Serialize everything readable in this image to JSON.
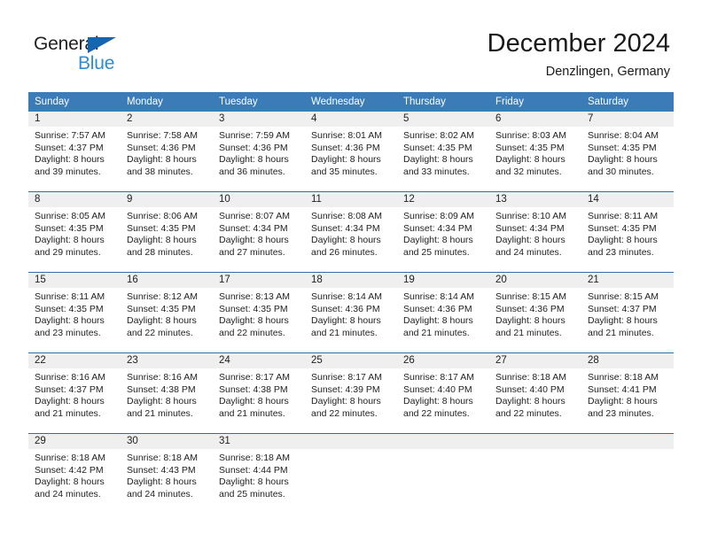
{
  "brand": {
    "name_part1": "General",
    "name_part2": "Blue",
    "triangle_color": "#1565b0",
    "blue_text_color": "#2b8cd9"
  },
  "header": {
    "title": "December 2024",
    "subtitle": "Denzlingen, Germany"
  },
  "theme": {
    "header_bg": "#3b7cb8",
    "header_text": "#ffffff",
    "daynum_bg": "#efefef",
    "row_divider": "#2f6ea8"
  },
  "columns": [
    "Sunday",
    "Monday",
    "Tuesday",
    "Wednesday",
    "Thursday",
    "Friday",
    "Saturday"
  ],
  "weeks": [
    [
      {
        "day": "1",
        "sunrise": "Sunrise: 7:57 AM",
        "sunset": "Sunset: 4:37 PM",
        "daylight1": "Daylight: 8 hours",
        "daylight2": "and 39 minutes."
      },
      {
        "day": "2",
        "sunrise": "Sunrise: 7:58 AM",
        "sunset": "Sunset: 4:36 PM",
        "daylight1": "Daylight: 8 hours",
        "daylight2": "and 38 minutes."
      },
      {
        "day": "3",
        "sunrise": "Sunrise: 7:59 AM",
        "sunset": "Sunset: 4:36 PM",
        "daylight1": "Daylight: 8 hours",
        "daylight2": "and 36 minutes."
      },
      {
        "day": "4",
        "sunrise": "Sunrise: 8:01 AM",
        "sunset": "Sunset: 4:36 PM",
        "daylight1": "Daylight: 8 hours",
        "daylight2": "and 35 minutes."
      },
      {
        "day": "5",
        "sunrise": "Sunrise: 8:02 AM",
        "sunset": "Sunset: 4:35 PM",
        "daylight1": "Daylight: 8 hours",
        "daylight2": "and 33 minutes."
      },
      {
        "day": "6",
        "sunrise": "Sunrise: 8:03 AM",
        "sunset": "Sunset: 4:35 PM",
        "daylight1": "Daylight: 8 hours",
        "daylight2": "and 32 minutes."
      },
      {
        "day": "7",
        "sunrise": "Sunrise: 8:04 AM",
        "sunset": "Sunset: 4:35 PM",
        "daylight1": "Daylight: 8 hours",
        "daylight2": "and 30 minutes."
      }
    ],
    [
      {
        "day": "8",
        "sunrise": "Sunrise: 8:05 AM",
        "sunset": "Sunset: 4:35 PM",
        "daylight1": "Daylight: 8 hours",
        "daylight2": "and 29 minutes."
      },
      {
        "day": "9",
        "sunrise": "Sunrise: 8:06 AM",
        "sunset": "Sunset: 4:35 PM",
        "daylight1": "Daylight: 8 hours",
        "daylight2": "and 28 minutes."
      },
      {
        "day": "10",
        "sunrise": "Sunrise: 8:07 AM",
        "sunset": "Sunset: 4:34 PM",
        "daylight1": "Daylight: 8 hours",
        "daylight2": "and 27 minutes."
      },
      {
        "day": "11",
        "sunrise": "Sunrise: 8:08 AM",
        "sunset": "Sunset: 4:34 PM",
        "daylight1": "Daylight: 8 hours",
        "daylight2": "and 26 minutes."
      },
      {
        "day": "12",
        "sunrise": "Sunrise: 8:09 AM",
        "sunset": "Sunset: 4:34 PM",
        "daylight1": "Daylight: 8 hours",
        "daylight2": "and 25 minutes."
      },
      {
        "day": "13",
        "sunrise": "Sunrise: 8:10 AM",
        "sunset": "Sunset: 4:34 PM",
        "daylight1": "Daylight: 8 hours",
        "daylight2": "and 24 minutes."
      },
      {
        "day": "14",
        "sunrise": "Sunrise: 8:11 AM",
        "sunset": "Sunset: 4:35 PM",
        "daylight1": "Daylight: 8 hours",
        "daylight2": "and 23 minutes."
      }
    ],
    [
      {
        "day": "15",
        "sunrise": "Sunrise: 8:11 AM",
        "sunset": "Sunset: 4:35 PM",
        "daylight1": "Daylight: 8 hours",
        "daylight2": "and 23 minutes."
      },
      {
        "day": "16",
        "sunrise": "Sunrise: 8:12 AM",
        "sunset": "Sunset: 4:35 PM",
        "daylight1": "Daylight: 8 hours",
        "daylight2": "and 22 minutes."
      },
      {
        "day": "17",
        "sunrise": "Sunrise: 8:13 AM",
        "sunset": "Sunset: 4:35 PM",
        "daylight1": "Daylight: 8 hours",
        "daylight2": "and 22 minutes."
      },
      {
        "day": "18",
        "sunrise": "Sunrise: 8:14 AM",
        "sunset": "Sunset: 4:36 PM",
        "daylight1": "Daylight: 8 hours",
        "daylight2": "and 21 minutes."
      },
      {
        "day": "19",
        "sunrise": "Sunrise: 8:14 AM",
        "sunset": "Sunset: 4:36 PM",
        "daylight1": "Daylight: 8 hours",
        "daylight2": "and 21 minutes."
      },
      {
        "day": "20",
        "sunrise": "Sunrise: 8:15 AM",
        "sunset": "Sunset: 4:36 PM",
        "daylight1": "Daylight: 8 hours",
        "daylight2": "and 21 minutes."
      },
      {
        "day": "21",
        "sunrise": "Sunrise: 8:15 AM",
        "sunset": "Sunset: 4:37 PM",
        "daylight1": "Daylight: 8 hours",
        "daylight2": "and 21 minutes."
      }
    ],
    [
      {
        "day": "22",
        "sunrise": "Sunrise: 8:16 AM",
        "sunset": "Sunset: 4:37 PM",
        "daylight1": "Daylight: 8 hours",
        "daylight2": "and 21 minutes."
      },
      {
        "day": "23",
        "sunrise": "Sunrise: 8:16 AM",
        "sunset": "Sunset: 4:38 PM",
        "daylight1": "Daylight: 8 hours",
        "daylight2": "and 21 minutes."
      },
      {
        "day": "24",
        "sunrise": "Sunrise: 8:17 AM",
        "sunset": "Sunset: 4:38 PM",
        "daylight1": "Daylight: 8 hours",
        "daylight2": "and 21 minutes."
      },
      {
        "day": "25",
        "sunrise": "Sunrise: 8:17 AM",
        "sunset": "Sunset: 4:39 PM",
        "daylight1": "Daylight: 8 hours",
        "daylight2": "and 22 minutes."
      },
      {
        "day": "26",
        "sunrise": "Sunrise: 8:17 AM",
        "sunset": "Sunset: 4:40 PM",
        "daylight1": "Daylight: 8 hours",
        "daylight2": "and 22 minutes."
      },
      {
        "day": "27",
        "sunrise": "Sunrise: 8:18 AM",
        "sunset": "Sunset: 4:40 PM",
        "daylight1": "Daylight: 8 hours",
        "daylight2": "and 22 minutes."
      },
      {
        "day": "28",
        "sunrise": "Sunrise: 8:18 AM",
        "sunset": "Sunset: 4:41 PM",
        "daylight1": "Daylight: 8 hours",
        "daylight2": "and 23 minutes."
      }
    ],
    [
      {
        "day": "29",
        "sunrise": "Sunrise: 8:18 AM",
        "sunset": "Sunset: 4:42 PM",
        "daylight1": "Daylight: 8 hours",
        "daylight2": "and 24 minutes."
      },
      {
        "day": "30",
        "sunrise": "Sunrise: 8:18 AM",
        "sunset": "Sunset: 4:43 PM",
        "daylight1": "Daylight: 8 hours",
        "daylight2": "and 24 minutes."
      },
      {
        "day": "31",
        "sunrise": "Sunrise: 8:18 AM",
        "sunset": "Sunset: 4:44 PM",
        "daylight1": "Daylight: 8 hours",
        "daylight2": "and 25 minutes."
      },
      {
        "day": "",
        "sunrise": "",
        "sunset": "",
        "daylight1": "",
        "daylight2": ""
      },
      {
        "day": "",
        "sunrise": "",
        "sunset": "",
        "daylight1": "",
        "daylight2": ""
      },
      {
        "day": "",
        "sunrise": "",
        "sunset": "",
        "daylight1": "",
        "daylight2": ""
      },
      {
        "day": "",
        "sunrise": "",
        "sunset": "",
        "daylight1": "",
        "daylight2": ""
      }
    ]
  ]
}
